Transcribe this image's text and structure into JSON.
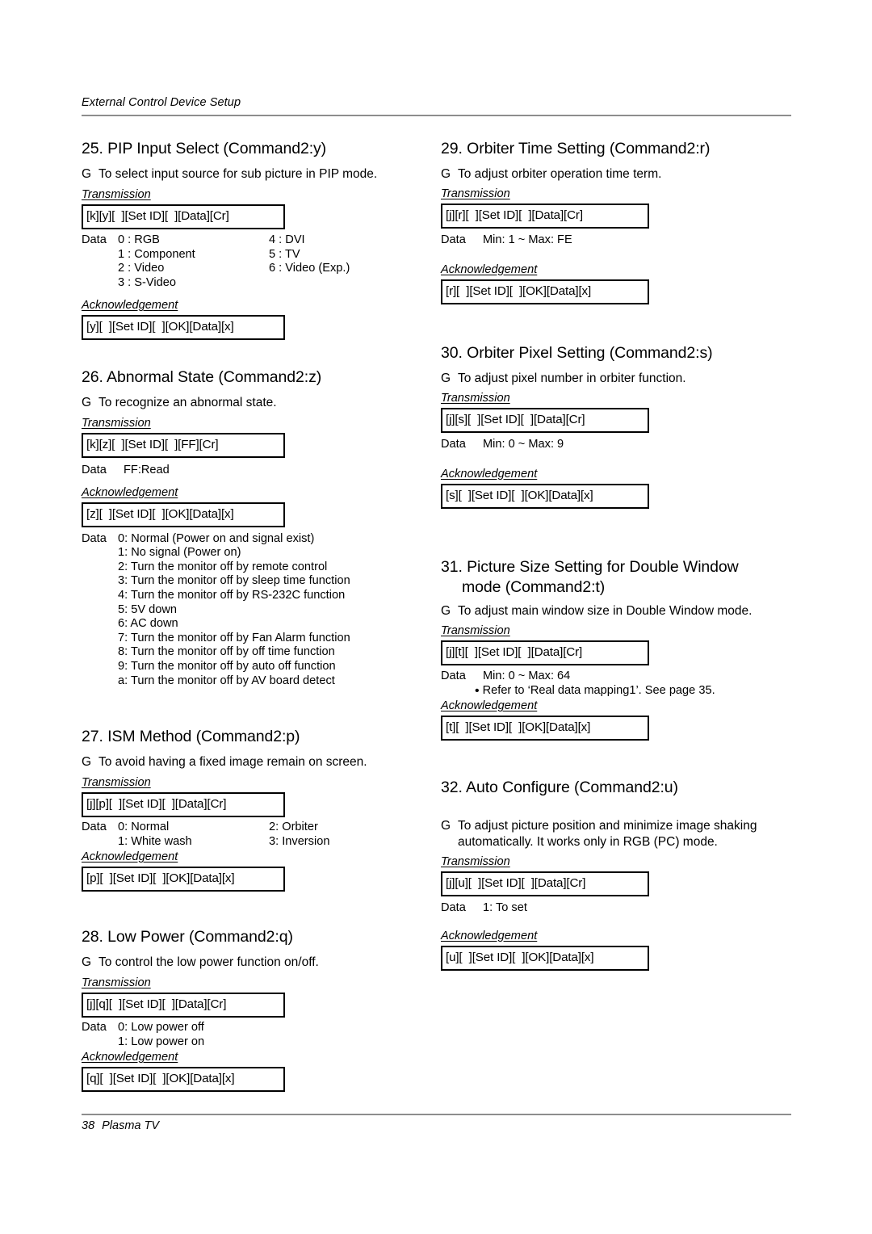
{
  "header": {
    "running_head": "External Control Device Setup"
  },
  "footer": {
    "page_number": "38",
    "product": "Plasma TV"
  },
  "labels": {
    "transmission": "Transmission",
    "acknowledgement": "Acknowledgement",
    "data": "Data",
    "g_marker": "G"
  },
  "sections": {
    "s25": {
      "heading": "25. PIP Input Select (Command2:y)",
      "description": "To select input source for sub picture in PIP mode.",
      "transmission": "[k][y][  ][Set ID][  ][Data][Cr]",
      "acknowledgement": "[y][  ][Set ID][  ][OK][Data][x]",
      "data_col1": [
        "0 : RGB",
        "1 : Component",
        "2 : Video",
        "3 : S-Video"
      ],
      "data_col2": [
        "4 : DVI",
        "5 : TV",
        "6 : Video (Exp.)"
      ]
    },
    "s26": {
      "heading": "26. Abnormal State (Command2:z)",
      "description": "To recognize an abnormal state.",
      "transmission": "[k][z][  ][Set ID][  ][FF][Cr]",
      "data_tx": "FF:Read",
      "acknowledgement": "[z][  ][Set ID][  ][OK][Data][x]",
      "data_ack": [
        "0: Normal (Power on and signal exist)",
        "1: No signal (Power on)",
        "2: Turn the monitor off by remote control",
        "3: Turn the monitor off by sleep time function",
        "4: Turn the monitor off by RS-232C function",
        "5: 5V down",
        "6: AC down",
        "7: Turn the monitor off by Fan Alarm function",
        "8: Turn the monitor off by off time function",
        "9: Turn the monitor off by auto off function",
        "a: Turn the monitor off by AV board detect"
      ]
    },
    "s27": {
      "heading": "27. ISM Method (Command2:p)",
      "description": "To avoid having a fixed image remain on screen.",
      "transmission": "[j][p][  ][Set ID][  ][Data][Cr]",
      "acknowledgement": "[p][  ][Set ID][  ][OK][Data][x]",
      "data_col1": [
        "0: Normal",
        "1: White wash"
      ],
      "data_col2": [
        "2: Orbiter",
        "3: Inversion"
      ]
    },
    "s28": {
      "heading": "28. Low Power (Command2:q)",
      "description": "To control the low power function on/off.",
      "transmission": "[j][q][  ][Set ID][  ][Data][Cr]",
      "acknowledgement": "[q][  ][Set ID][  ][OK][Data][x]",
      "data_col1": [
        "0: Low power off",
        "1: Low power on"
      ]
    },
    "s29": {
      "heading": "29. Orbiter Time Setting (Command2:r)",
      "description": "To adjust orbiter operation time term.",
      "transmission": "[j][r][  ][Set ID][  ][Data][Cr]",
      "data_range": "Min: 1 ~ Max: FE",
      "acknowledgement": "[r][  ][Set ID][  ][OK][Data][x]"
    },
    "s30": {
      "heading": "30. Orbiter Pixel Setting (Command2:s)",
      "description": "To adjust pixel number in orbiter function.",
      "transmission": "[j][s][  ][Set ID][  ][Data][Cr]",
      "data_range": "Min: 0 ~ Max: 9",
      "acknowledgement": "[s][  ][Set ID][  ][OK][Data][x]"
    },
    "s31": {
      "heading_line1": "31. Picture Size Setting for Double Window",
      "heading_line2": "mode (Command2:t)",
      "description": "To adjust main window size in Double Window mode.",
      "transmission": "[j][t][  ][Set ID][  ][Data][Cr]",
      "data_range": "Min: 0 ~ Max: 64",
      "note": "Refer to ‘Real data mapping1’. See page 35.",
      "acknowledgement": "[t][  ][Set ID][  ][OK][Data][x]"
    },
    "s32": {
      "heading": "32. Auto Configure (Command2:u)",
      "description_line1": "To adjust picture position and minimize image shaking",
      "description_line2": "automatically. It works only in RGB (PC) mode.",
      "transmission": "[j][u][  ][Set ID][  ][Data][Cr]",
      "data_value": "1: To set",
      "acknowledgement": "[u][  ][Set ID][  ][OK][Data][x]"
    }
  }
}
